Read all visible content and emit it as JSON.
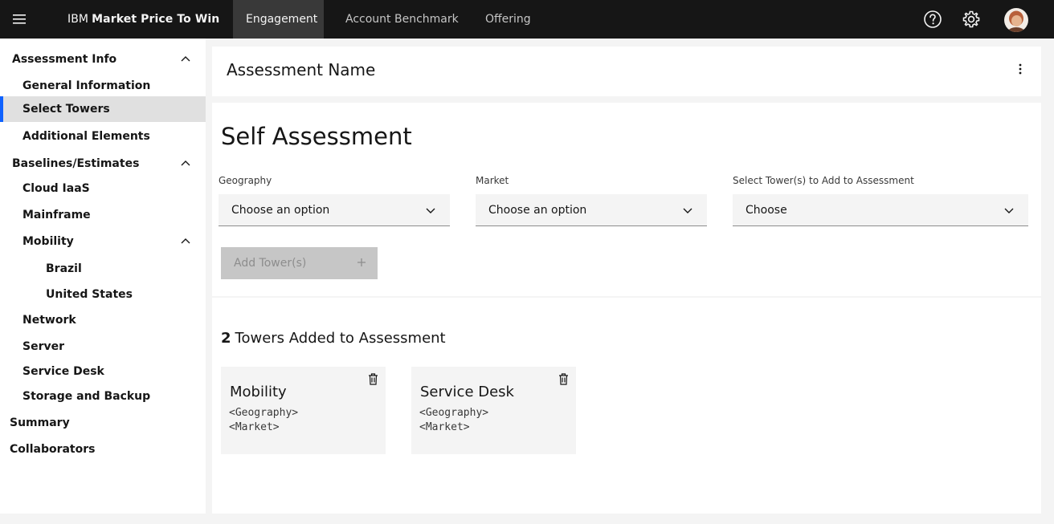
{
  "header": {
    "brand_prefix": "IBM",
    "brand_name": "Market Price To Win",
    "tabs": [
      {
        "label": "Engagement",
        "active": true
      },
      {
        "label": "Account Benchmark",
        "active": false
      },
      {
        "label": "Offering",
        "active": false
      }
    ],
    "icons": [
      "menu-icon",
      "help-icon",
      "settings-icon",
      "avatar"
    ]
  },
  "sidebar": {
    "items": [
      {
        "label": "Assessment Info",
        "level": 1,
        "expanded": true
      },
      {
        "label": "General Information",
        "level": 2
      },
      {
        "label": "Select Towers",
        "level": 2,
        "selected": true
      },
      {
        "label": "Additional Elements",
        "level": 2
      },
      {
        "label": "Baselines/Estimates",
        "level": 1,
        "expanded": true
      },
      {
        "label": "Cloud IaaS",
        "level": 2
      },
      {
        "label": "Mainframe",
        "level": 2
      },
      {
        "label": "Mobility",
        "level": 2,
        "expanded": true
      },
      {
        "label": "Brazil",
        "level": 3
      },
      {
        "label": "United States",
        "level": 3
      },
      {
        "label": "Network",
        "level": 2
      },
      {
        "label": "Server",
        "level": 2
      },
      {
        "label": "Service Desk",
        "level": 2
      },
      {
        "label": "Storage and Backup",
        "level": 2
      },
      {
        "label": "Summary",
        "level": 0
      },
      {
        "label": "Collaborators",
        "level": 0
      }
    ]
  },
  "main": {
    "assessment_name": "Assessment Name",
    "section_title": "Self Assessment",
    "fields": [
      {
        "label": "Geography",
        "value": "Choose an option"
      },
      {
        "label": "Market",
        "value": "Choose an option"
      },
      {
        "label": "Select Tower(s) to Add to Assessment",
        "value": "Choose"
      }
    ],
    "add_button_label": "Add Tower(s)",
    "towers_count": "2",
    "towers_heading": "Towers Added to Assessment",
    "towers": [
      {
        "name": "Mobility",
        "geography": "<Geography>",
        "market": "<Market>"
      },
      {
        "name": "Service Desk",
        "geography": "<Geography>",
        "market": "<Market>"
      }
    ]
  },
  "colors": {
    "header_bg": "#161616",
    "accent": "#0f62fe",
    "selected_bg": "#e0e0e0",
    "disabled_bg": "#c6c6c6"
  }
}
